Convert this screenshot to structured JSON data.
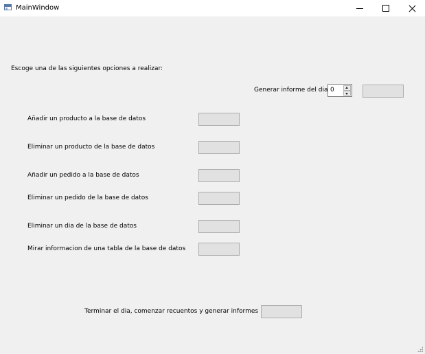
{
  "window": {
    "title": "MainWindow",
    "icons": {
      "app": "app-window-icon",
      "minimize": "minimize-icon",
      "maximize": "maximize-icon",
      "close": "close-icon"
    }
  },
  "main": {
    "prompt": "Escoge una de las siguientes opciones a realizar:",
    "report": {
      "label": "Generar informe del dia:",
      "day_value": "0",
      "button_label": ""
    },
    "options": [
      {
        "label": "Añadir un producto a la base de datos",
        "button_label": ""
      },
      {
        "label": "Eliminar un producto de la base de datos",
        "button_label": ""
      },
      {
        "label": "Añadir un pedido a la base de datos",
        "button_label": ""
      },
      {
        "label": "Eliminar un pedido de la base de datos",
        "button_label": ""
      },
      {
        "label": "Eliminar un dia de la base de datos",
        "button_label": ""
      },
      {
        "label": "Mirar informacion de una tabla de la base de datos",
        "button_label": ""
      }
    ],
    "finish": {
      "label": "Terminar el dia, comenzar recuentos y generar informes",
      "button_label": ""
    }
  },
  "colors": {
    "background": "#f0f0f0",
    "titlebar": "#ffffff",
    "button_face": "#e1e1e1",
    "button_border": "#adadad"
  }
}
